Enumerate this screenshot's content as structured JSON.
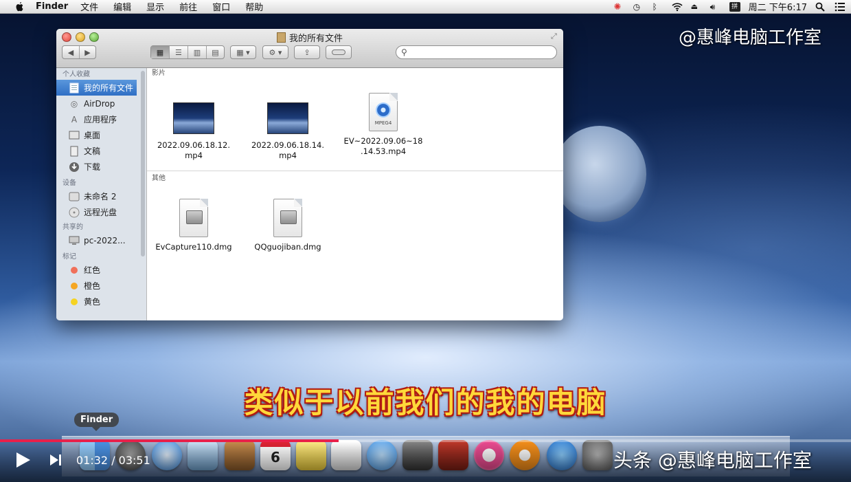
{
  "menubar": {
    "app": "Finder",
    "items": [
      "文件",
      "编辑",
      "显示",
      "前往",
      "窗口",
      "帮助"
    ],
    "clock": "周二 下午6:17"
  },
  "watermark_top": "@惠峰电脑工作室",
  "window": {
    "title": "我的所有文件",
    "search_placeholder": "",
    "sidebar": {
      "favorites_header": "个人收藏",
      "favorites": [
        {
          "label": "我的所有文件",
          "icon": "all-files-icon"
        },
        {
          "label": "AirDrop",
          "icon": "airdrop-icon"
        },
        {
          "label": "应用程序",
          "icon": "applications-icon"
        },
        {
          "label": "桌面",
          "icon": "desktop-icon"
        },
        {
          "label": "文稿",
          "icon": "documents-icon"
        },
        {
          "label": "下载",
          "icon": "downloads-icon"
        }
      ],
      "devices_header": "设备",
      "devices": [
        {
          "label": "未命名 2",
          "icon": "disk-icon"
        },
        {
          "label": "远程光盘",
          "icon": "optical-disc-icon"
        }
      ],
      "shared_header": "共享的",
      "shared": [
        {
          "label": "pc-2022...",
          "icon": "computer-icon"
        }
      ],
      "tags_header": "标记",
      "tags": [
        {
          "label": "红色",
          "color": "#f0705a"
        },
        {
          "label": "橙色",
          "color": "#f5a623"
        },
        {
          "label": "黄色",
          "color": "#f5d323"
        }
      ]
    },
    "sections": [
      {
        "header": "影片",
        "files": [
          {
            "name_line1": "2022.09.06.18.12.",
            "name_line2": "mp4",
            "kind": "video-thumbnail"
          },
          {
            "name_line1": "2022.09.06.18.14.",
            "name_line2": "mp4",
            "kind": "video-thumbnail"
          },
          {
            "name_line1": "EV~2022.09.06~18",
            "name_line2": ".14.53.mp4",
            "kind": "mpeg4-doc",
            "badge": "MPEG4"
          }
        ]
      },
      {
        "header": "其他",
        "files": [
          {
            "name_line1": "EvCapture110.dmg",
            "kind": "dmg-doc"
          },
          {
            "name_line1": "QQguojiban.dmg",
            "kind": "dmg-doc"
          }
        ]
      }
    ]
  },
  "subtitle": "类似于以前我们的我的电脑",
  "dock_tooltip": "Finder",
  "dock": {
    "calendar_day": "6",
    "icons": [
      "finder-icon",
      "launchpad-icon",
      "safari-icon",
      "mail-icon",
      "contacts-icon",
      "calendar-icon",
      "notes-icon",
      "reminders-icon",
      "messages-icon",
      "facetime-icon",
      "photobooth-icon",
      "itunes-icon",
      "ibooks-icon",
      "appstore-icon",
      "system-preferences-icon"
    ]
  },
  "player": {
    "current_time": "01:32",
    "separator": " / ",
    "duration": "03:51",
    "progress_fraction": 0.398
  },
  "watermark_bottom": "头条 @惠峰电脑工作室"
}
